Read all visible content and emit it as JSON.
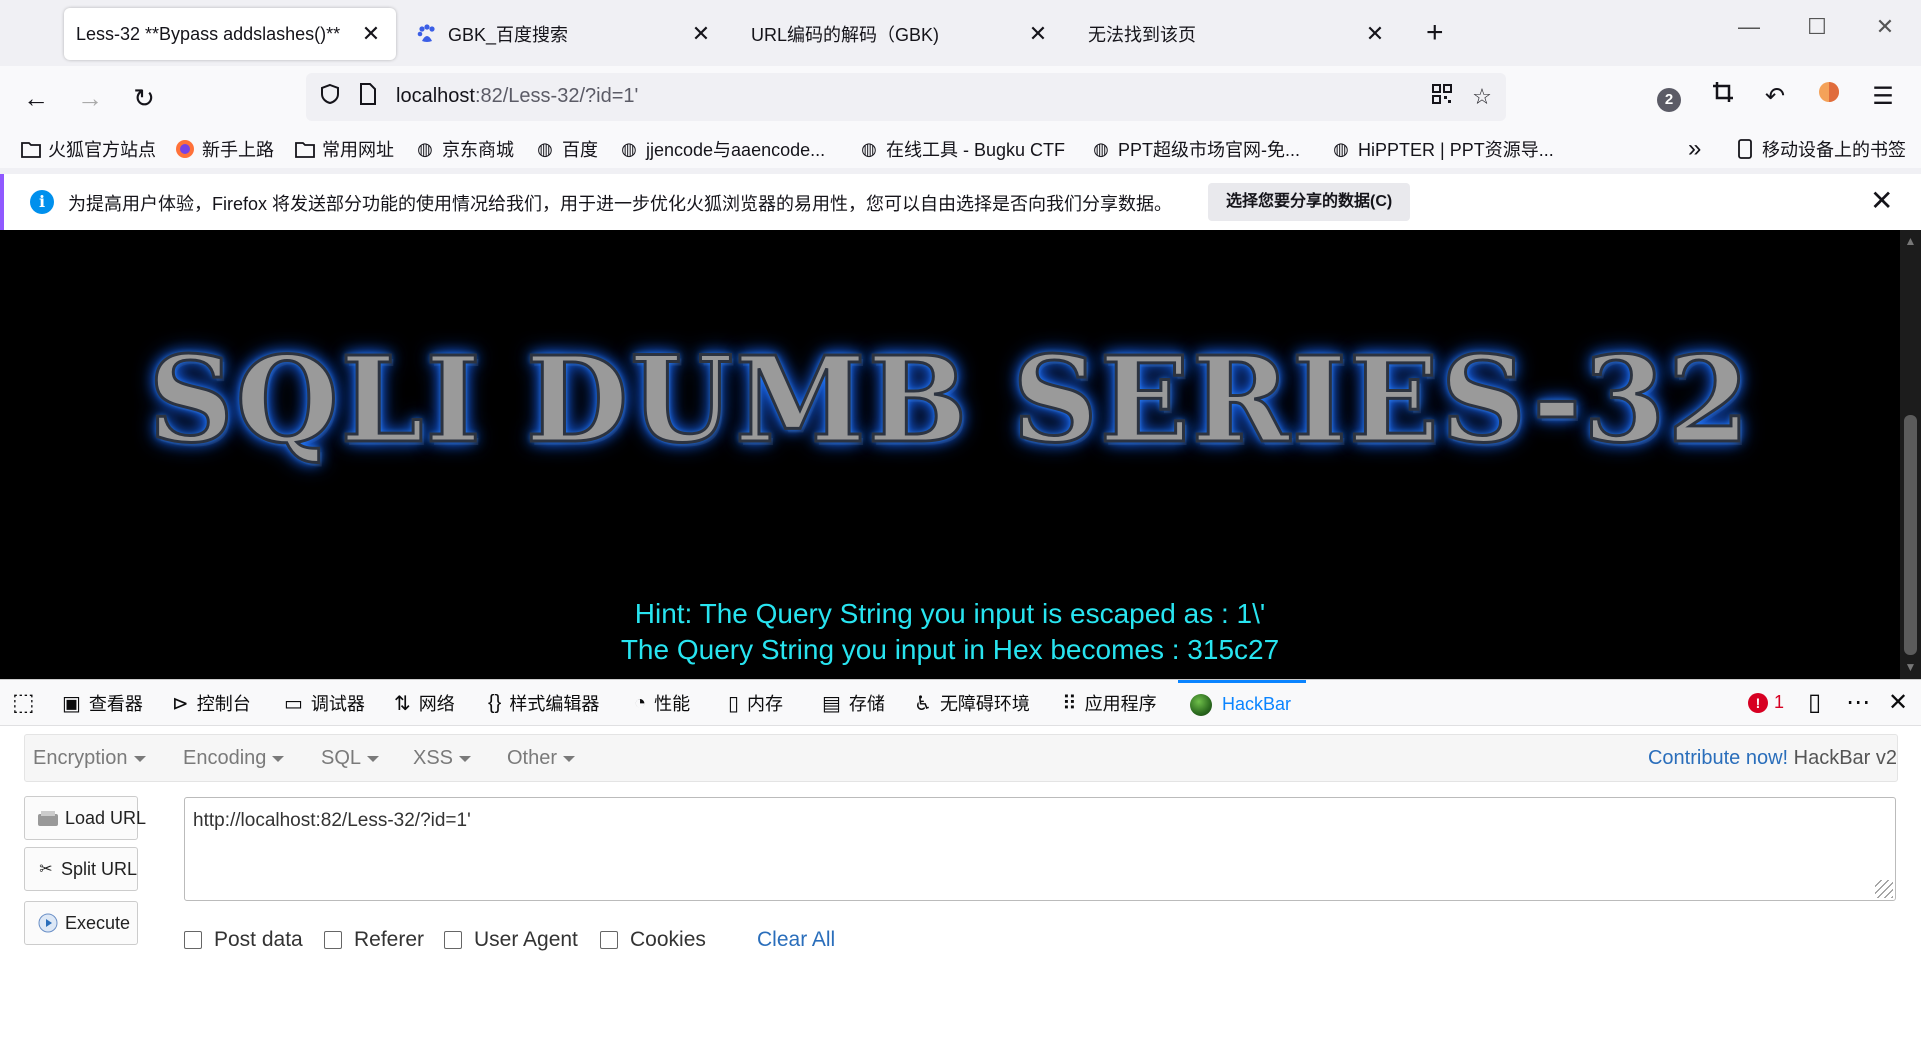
{
  "tabs": [
    {
      "label": "Less-32 **Bypass addslashes()**",
      "active": true
    },
    {
      "label": "GBK_百度搜索",
      "active": false
    },
    {
      "label": "URL编码的解码（GBK)",
      "active": false
    },
    {
      "label": "无法找到该页",
      "active": false
    }
  ],
  "window": {
    "minimize": "—",
    "maximize": "☐",
    "close": "✕",
    "new_tab": "+"
  },
  "nav": {
    "url_host": "localhost",
    "url_rest": ":82/Less-32/?id=1'",
    "badge_count": "2"
  },
  "bookmarks": [
    {
      "label": "火狐官方站点",
      "icon": "folder-icon"
    },
    {
      "label": "新手上路",
      "icon": "firefox-icon"
    },
    {
      "label": "常用网址",
      "icon": "folder-icon"
    },
    {
      "label": "京东商城",
      "icon": "globe-icon"
    },
    {
      "label": "百度",
      "icon": "globe-icon"
    },
    {
      "label": "jjencode与aaencode...",
      "icon": "globe-icon"
    },
    {
      "label": "在线工具 - Bugku CTF",
      "icon": "globe-icon"
    },
    {
      "label": "PPT超级市场官网-免...",
      "icon": "globe-icon"
    },
    {
      "label": "HiPPTER | PPT资源导...",
      "icon": "globe-icon"
    }
  ],
  "mobile_bookmarks": "移动设备上的书签",
  "notification": {
    "text": "为提高用户体验，Firefox 将发送部分功能的使用情况给我们，用于进一步优化火狐浏览器的易用性，您可以自由选择是否向我们分享数据。",
    "button": "选择您要分享的数据(C)"
  },
  "page": {
    "title": "SQLI DUMB SERIES-32",
    "hint_line1": "Hint: The Query String you input is escaped as : 1\\'",
    "hint_line2": "The Query String you input in Hex becomes : 315c27"
  },
  "devtools": {
    "tabs": [
      {
        "label": "查看器",
        "icon": "inspector-icon"
      },
      {
        "label": "控制台",
        "icon": "console-icon"
      },
      {
        "label": "调试器",
        "icon": "debugger-icon"
      },
      {
        "label": "网络",
        "icon": "network-icon"
      },
      {
        "label": "样式编辑器",
        "icon": "style-editor-icon"
      },
      {
        "label": "性能",
        "icon": "performance-icon"
      },
      {
        "label": "内存",
        "icon": "memory-icon"
      },
      {
        "label": "存储",
        "icon": "storage-icon"
      },
      {
        "label": "无障碍环境",
        "icon": "accessibility-icon"
      },
      {
        "label": "应用程序",
        "icon": "application-icon"
      },
      {
        "label": "HackBar",
        "icon": "hackbar-icon"
      }
    ],
    "error_count": "1",
    "error_icon": "!"
  },
  "hackbar": {
    "menu": [
      "Encryption",
      "Encoding",
      "SQL",
      "XSS",
      "Other"
    ],
    "contribute": "Contribute now!",
    "version": "HackBar v2",
    "buttons": {
      "load": "Load URL",
      "split": "Split URL",
      "execute": "Execute"
    },
    "url_value": "http://localhost:82/Less-32/?id=1'",
    "options": [
      "Post data",
      "Referer",
      "User Agent",
      "Cookies"
    ],
    "clear_all": "Clear All"
  }
}
